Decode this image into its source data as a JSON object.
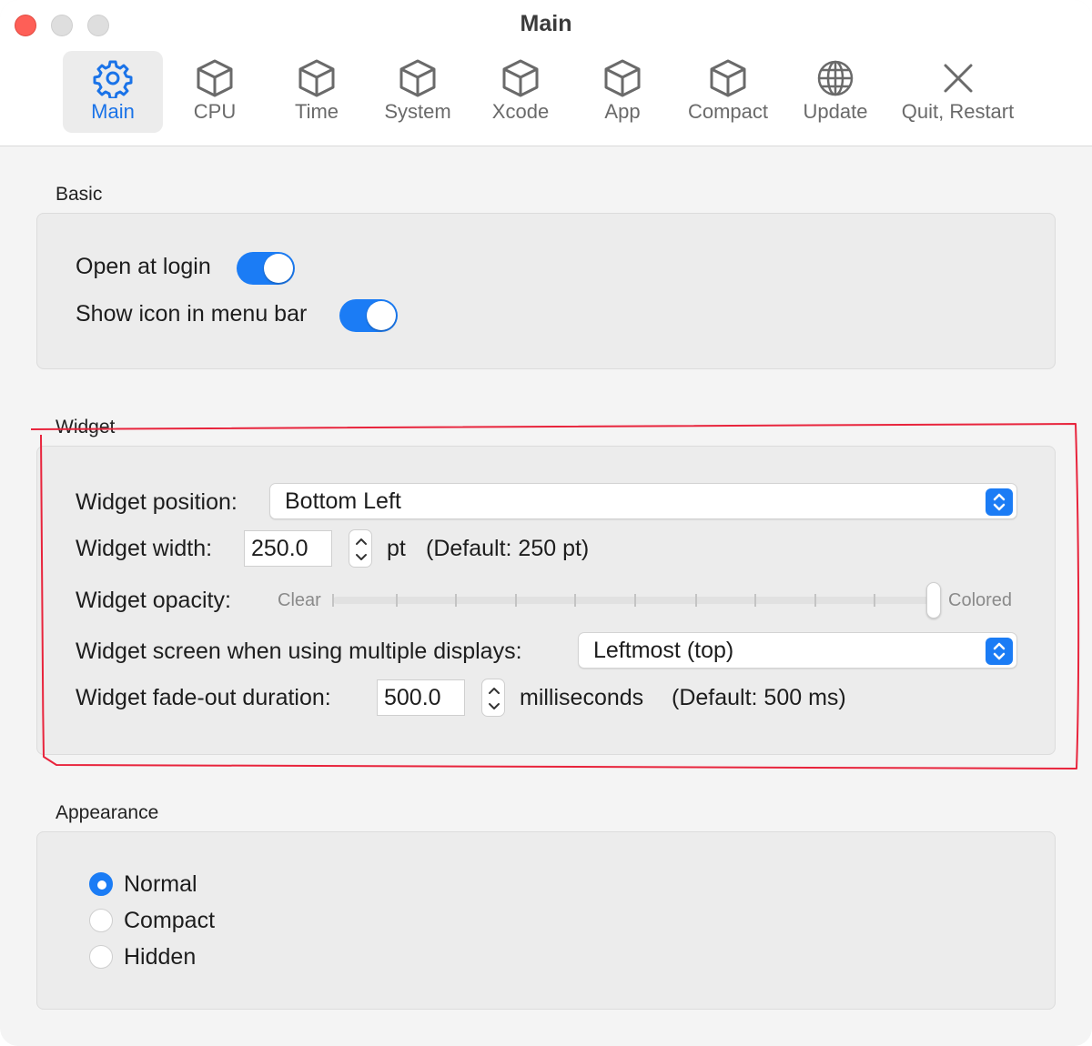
{
  "window": {
    "title": "Main"
  },
  "tabs": [
    {
      "label": "Main",
      "icon": "gear-icon",
      "active": true
    },
    {
      "label": "CPU",
      "icon": "cube-icon"
    },
    {
      "label": "Time",
      "icon": "cube-icon"
    },
    {
      "label": "System",
      "icon": "cube-icon"
    },
    {
      "label": "Xcode",
      "icon": "cube-icon"
    },
    {
      "label": "App",
      "icon": "cube-icon"
    },
    {
      "label": "Compact",
      "icon": "cube-icon"
    },
    {
      "label": "Update",
      "icon": "globe-icon"
    },
    {
      "label": "Quit, Restart",
      "icon": "close-x-icon"
    }
  ],
  "basic": {
    "title": "Basic",
    "open_at_login_label": "Open at login",
    "open_at_login": true,
    "show_icon_label": "Show icon in menu bar",
    "show_icon": true
  },
  "widget": {
    "title": "Widget",
    "position_label": "Widget position:",
    "position_value": "Bottom Left",
    "width_label": "Widget width:",
    "width_value": "250.0",
    "width_unit": "pt",
    "width_default": "(Default: 250 pt)",
    "opacity_label": "Widget opacity:",
    "opacity_min_label": "Clear",
    "opacity_max_label": "Colored",
    "opacity_level": 1.0,
    "screen_label": "Widget screen when using multiple displays:",
    "screen_value": "Leftmost (top)",
    "fade_label": "Widget fade-out duration:",
    "fade_value": "500.0",
    "fade_unit": "milliseconds",
    "fade_default": "(Default: 500 ms)"
  },
  "appearance": {
    "title": "Appearance",
    "options": [
      {
        "label": "Normal",
        "selected": true
      },
      {
        "label": "Compact",
        "selected": false
      },
      {
        "label": "Hidden",
        "selected": false
      }
    ]
  },
  "colors": {
    "accent": "#1b7cf5",
    "close_button": "#fe5f57",
    "annotation": "#e8243c"
  }
}
